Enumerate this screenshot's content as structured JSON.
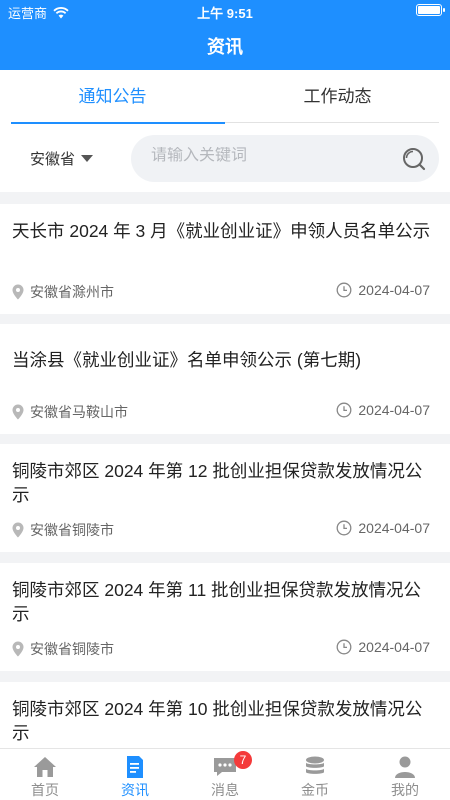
{
  "status_bar": {
    "carrier": "运营商",
    "time": "上午 9:51"
  },
  "header": {
    "title": "资讯"
  },
  "tabs": [
    {
      "label": "通知公告",
      "active": true
    },
    {
      "label": "工作动态",
      "active": false
    }
  ],
  "filter": {
    "province": "安徽省",
    "search_placeholder": "请输入关键词"
  },
  "articles": [
    {
      "title": "天长市 2024 年 3 月《就业创业证》申领人员名单公示",
      "location": "安徽省滁州市",
      "date": "2024-04-07"
    },
    {
      "title": "当涂县《就业创业证》名单申领公示 (第七期)",
      "location": "安徽省马鞍山市",
      "date": "2024-04-07"
    },
    {
      "title": "铜陵市郊区 2024 年第 12 批创业担保贷款发放情况公示",
      "location": "安徽省铜陵市",
      "date": "2024-04-07"
    },
    {
      "title": "铜陵市郊区 2024 年第 11 批创业担保贷款发放情况公示",
      "location": "安徽省铜陵市",
      "date": "2024-04-07"
    },
    {
      "title": "铜陵市郊区 2024 年第 10 批创业担保贷款发放情况公示",
      "location": "",
      "date": ""
    }
  ],
  "tabbar": {
    "items": [
      {
        "label": "首页",
        "icon": "home-icon",
        "active": false
      },
      {
        "label": "资讯",
        "icon": "document-icon",
        "active": true
      },
      {
        "label": "消息",
        "icon": "message-icon",
        "active": false,
        "badge": "7"
      },
      {
        "label": "金币",
        "icon": "coins-icon",
        "active": false
      },
      {
        "label": "我的",
        "icon": "person-icon",
        "active": false
      }
    ]
  },
  "colors": {
    "primary": "#1e8fff",
    "badge": "#f43a3a",
    "background": "#f2f3f5"
  }
}
